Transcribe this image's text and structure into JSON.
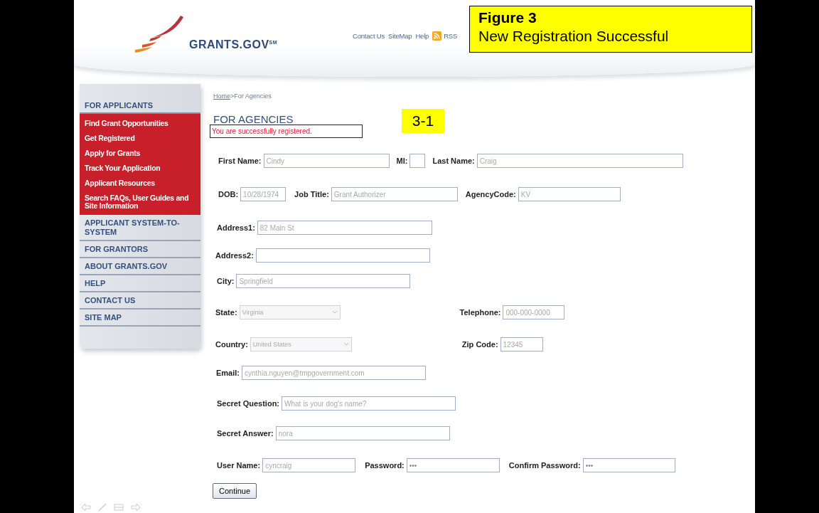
{
  "header": {
    "logo_text": "GRANTS.GOV$^{SM}$",
    "links": [
      {
        "label": "Contact Us",
        "kind": "link"
      },
      {
        "label": "SiteMap",
        "kind": "link"
      },
      {
        "label": "Help",
        "kind": "link"
      },
      {
        "label": "RSS",
        "kind": "rss"
      }
    ]
  },
  "callout": {
    "lines": [
      "Figure 3",
      "New Registration Successful"
    ]
  },
  "sidebar": {
    "sections": [
      {
        "label": "FOR APPLICANTS",
        "expanded": true,
        "children": [
          "Find Grant Opportunities",
          "Get Registered",
          "Apply for Grants",
          "Track Your Application",
          "Applicant Resources",
          "Search FAQs, User Guides and Site Information"
        ]
      },
      {
        "label": "APPLICANT SYSTEM-TO-SYSTEM"
      },
      {
        "label": "FOR GRANTORS"
      },
      {
        "label": "ABOUT GRANTS.GOV"
      },
      {
        "label": "HELP"
      },
      {
        "label": "CONTACT US"
      },
      {
        "label": "SITE MAP"
      }
    ]
  },
  "breadcrumb": {
    "link": "Home",
    "rest": ">For Agencies"
  },
  "page_title": "FOR AGENCIES",
  "message": "You are successfully registered.",
  "step_badge": "3-1",
  "form": {
    "rows": [
      [
        {
          "label": "First Name:",
          "kind": "text",
          "value": "Cindy"
        },
        {
          "label": "MI:",
          "kind": "text"
        },
        {
          "label": "Last Name:",
          "kind": "text",
          "value": "Craig"
        }
      ],
      [
        {
          "label": "DOB:",
          "kind": "text",
          "value": "10/28/1974"
        },
        {
          "label": "Job Title:",
          "kind": "text",
          "value": "Grant Authorizer"
        },
        {
          "label": "AgencyCode:",
          "kind": "text",
          "value": "KV"
        }
      ],
      [
        {
          "label": "Address1:",
          "kind": "text",
          "value": "82 Main St"
        }
      ],
      [
        {
          "label": "Address2:",
          "kind": "text"
        }
      ],
      [
        {
          "label": "City:",
          "kind": "text",
          "value": "Springfield"
        }
      ],
      [
        {
          "label": "State:",
          "kind": "select",
          "value": "Virginia"
        },
        {
          "label": "Telephone:",
          "kind": "text",
          "value": "000-000-0000"
        }
      ],
      [
        {
          "label": "Country:",
          "kind": "select",
          "value": "United States"
        },
        {
          "label": "Zip Code:",
          "kind": "text",
          "value": "12345"
        }
      ],
      [
        {
          "label": "Email:",
          "kind": "text",
          "value": "cynthia.nguyen@tmpgovernment.com"
        }
      ],
      [
        {
          "label": "Secret Question:",
          "kind": "text",
          "value": "What is your dog's name?"
        }
      ],
      [
        {
          "label": "Secret Answer:",
          "kind": "text",
          "value": "nora"
        }
      ],
      [
        {
          "label": "User Name:",
          "kind": "text",
          "value": "cyncraig"
        },
        {
          "label": "Password:",
          "kind": "password",
          "value": "•••"
        },
        {
          "label": "Confirm Password:",
          "kind": "password",
          "value": "•••"
        }
      ]
    ],
    "button": "Continue"
  }
}
